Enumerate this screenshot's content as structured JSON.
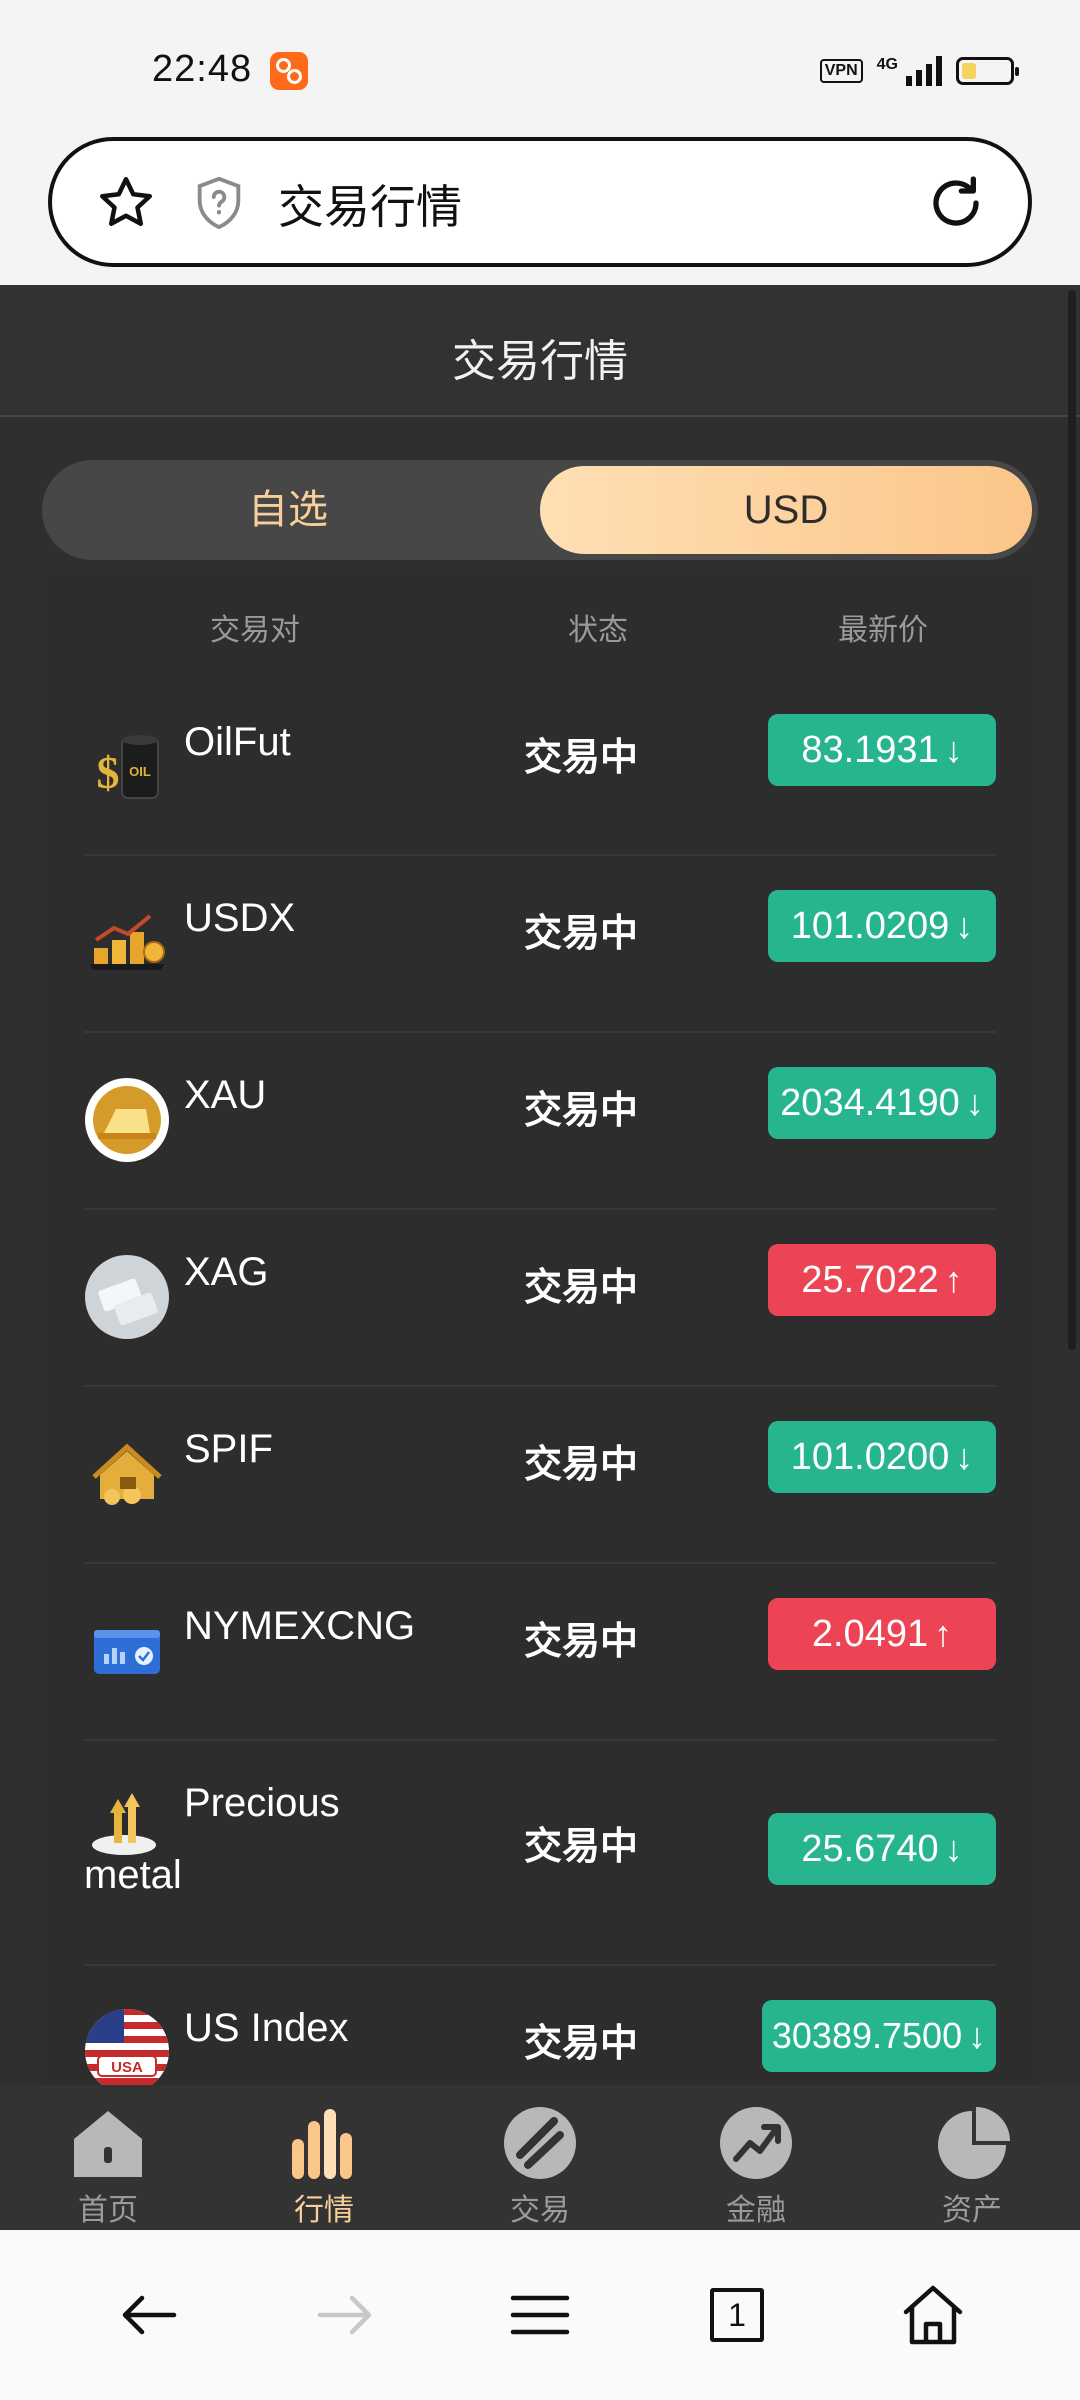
{
  "status_bar": {
    "time": "22:48",
    "vpn_label": "VPN",
    "network": "4G",
    "battery_icon": "battery-low-icon"
  },
  "browser": {
    "url_title": "交易行情",
    "bookmark_icon": "star-icon",
    "security_icon": "shield-question-icon",
    "reload_icon": "reload-icon"
  },
  "page": {
    "title": "交易行情"
  },
  "tabs": [
    {
      "label": "自选",
      "active": false
    },
    {
      "label": "USD",
      "active": true
    }
  ],
  "list": {
    "headers": {
      "pair": "交易对",
      "status": "状态",
      "price": "最新价"
    },
    "rows": [
      {
        "name": "OilFut",
        "status": "交易中",
        "price": "83.1931",
        "arrow": "↓",
        "trend": "down",
        "icon": "oil-barrel-icon"
      },
      {
        "name": "USDX",
        "status": "交易中",
        "price": "101.0209",
        "arrow": "↓",
        "trend": "down",
        "icon": "coin-stacks-icon"
      },
      {
        "name": "XAU",
        "status": "交易中",
        "price": "2034.4190",
        "arrow": "↓",
        "trend": "down",
        "icon": "gold-icon"
      },
      {
        "name": "XAG",
        "status": "交易中",
        "price": "25.7022",
        "arrow": "↑",
        "trend": "up",
        "icon": "silver-icon"
      },
      {
        "name": "SPIF",
        "status": "交易中",
        "price": "101.0200",
        "arrow": "↓",
        "trend": "down",
        "icon": "gold-house-icon"
      },
      {
        "name": "NYMEXCNG",
        "status": "交易中",
        "price": "2.0491",
        "arrow": "↑",
        "trend": "up",
        "icon": "monitor-icon"
      },
      {
        "name": "Precious metal",
        "name_line1": "Precious",
        "name_line2": "metal",
        "status": "交易中",
        "price": "25.6740",
        "arrow": "↓",
        "trend": "down",
        "icon": "precious-metal-icon"
      },
      {
        "name": "US Index",
        "status": "交易中",
        "price": "30389.7500",
        "arrow": "↓",
        "trend": "down",
        "icon": "usa-flag-icon"
      }
    ]
  },
  "app_nav": [
    {
      "label": "首页",
      "icon": "home-icon",
      "active": false
    },
    {
      "label": "行情",
      "icon": "market-bars-icon",
      "active": true
    },
    {
      "label": "交易",
      "icon": "trade-icon",
      "active": false
    },
    {
      "label": "金融",
      "icon": "finance-trend-icon",
      "active": false
    },
    {
      "label": "资产",
      "icon": "assets-pie-icon",
      "active": false
    }
  ],
  "system_nav": {
    "tab_count": "1"
  },
  "colors": {
    "up": "#ec4454",
    "down": "#26b58e",
    "accent": "#f8cf9b",
    "background": "#2f2f2f"
  }
}
